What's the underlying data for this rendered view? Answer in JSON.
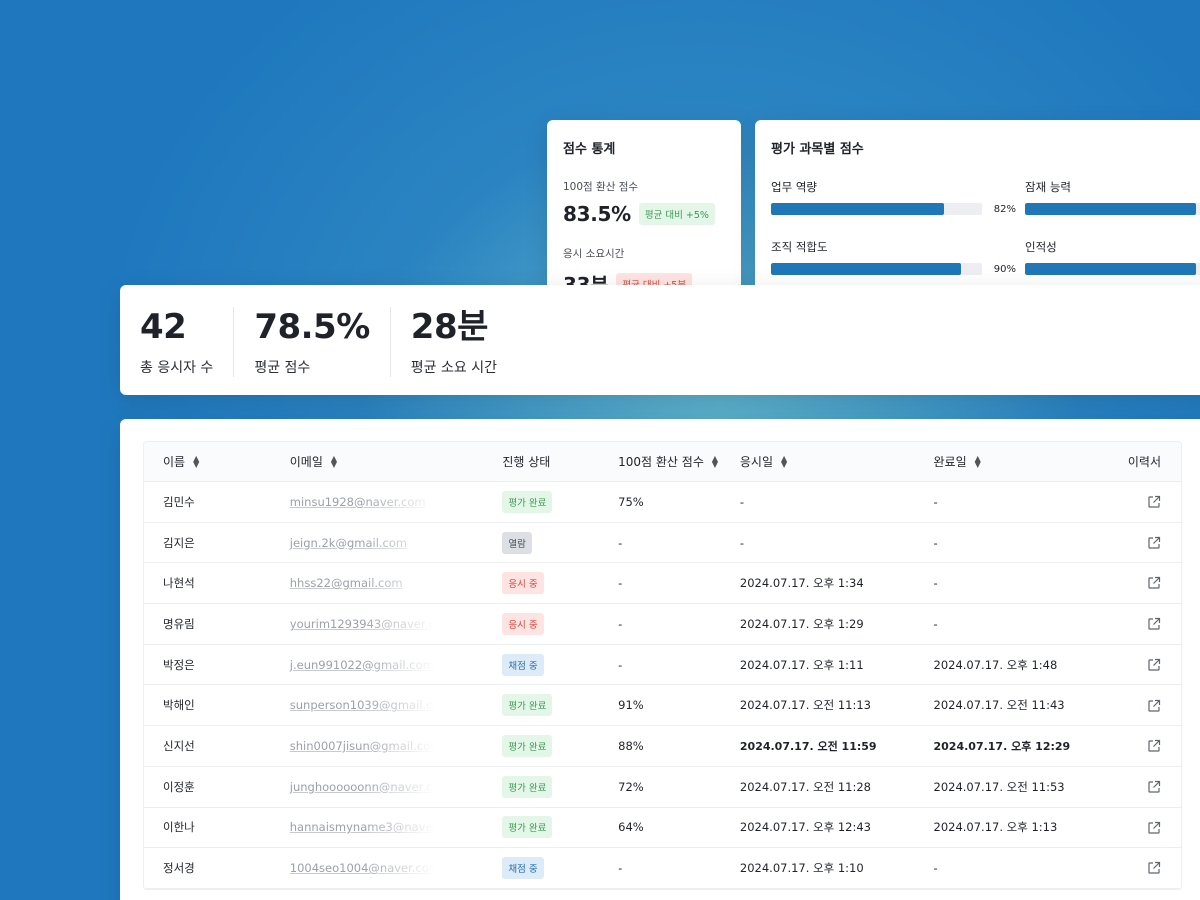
{
  "score_stats": {
    "title": "점수 통계",
    "converted_label": "100점 환산 점수",
    "converted_value": "83.5%",
    "converted_badge": "평균 대비 +5%",
    "time_label": "응시 소요시간",
    "time_value": "33분",
    "time_badge": "평균 대비 +5분"
  },
  "subject_scores": {
    "title": "평가 과목별 점수",
    "items": [
      {
        "label": "업무 역량",
        "percent": 82,
        "percent_text": "82%"
      },
      {
        "label": "잠재 능력",
        "percent": 95,
        "percent_text": ""
      },
      {
        "label": "조직 적합도",
        "percent": 90,
        "percent_text": "90%"
      },
      {
        "label": "인적성",
        "percent": 95,
        "percent_text": ""
      }
    ]
  },
  "summary": {
    "total_value": "42",
    "total_label": "총 응시자 수",
    "avg_score_value": "78.5%",
    "avg_score_label": "평균 점수",
    "avg_time_value": "28분",
    "avg_time_label": "평균 소요 시간"
  },
  "table": {
    "columns": {
      "name": "이름",
      "email": "이메일",
      "status": "진행 상태",
      "score": "100점 환산 점수",
      "start": "응시일",
      "end": "완료일",
      "history": "이력서"
    },
    "rows": [
      {
        "name": "김민수",
        "email": "minsu1928@naver.com",
        "status": "평가 완료",
        "status_type": "done",
        "score": "75%",
        "start": "-",
        "end": "-"
      },
      {
        "name": "김지은",
        "email": "jeign.2k@gmail.com",
        "status": "열람",
        "status_type": "open",
        "score": "-",
        "start": "-",
        "end": "-"
      },
      {
        "name": "나현석",
        "email": "hhss22@gmail.com",
        "status": "응시 중",
        "status_type": "taking",
        "score": "-",
        "start": "2024.07.17. 오후 1:34",
        "end": "-"
      },
      {
        "name": "명유림",
        "email": "yourim1293943@naver.com",
        "status": "응시 중",
        "status_type": "taking",
        "score": "-",
        "start": "2024.07.17. 오후 1:29",
        "end": "-"
      },
      {
        "name": "박정은",
        "email": "j.eun991022@gmail.com",
        "status": "채점 중",
        "status_type": "grading",
        "score": "-",
        "start": "2024.07.17. 오후 1:11",
        "end": "2024.07.17. 오후 1:48"
      },
      {
        "name": "박해인",
        "email": "sunperson1039@gmail.com",
        "status": "평가 완료",
        "status_type": "done",
        "score": "91%",
        "start": "2024.07.17. 오전 11:13",
        "end": "2024.07.17. 오전 11:43"
      },
      {
        "name": "신지선",
        "email": "shin0007jisun@gmail.com",
        "status": "평가 완료",
        "status_type": "done",
        "score": "88%",
        "start": "2024.07.17. 오전 11:59",
        "end": "2024.07.17. 오후 12:29",
        "bold": true
      },
      {
        "name": "이정훈",
        "email": "junghoooooonn@naver.com",
        "status": "평가 완료",
        "status_type": "done",
        "score": "72%",
        "start": "2024.07.17. 오전 11:28",
        "end": "2024.07.17. 오전 11:53"
      },
      {
        "name": "이한나",
        "email": "hannaismyname3@naver.com",
        "status": "평가 완료",
        "status_type": "done",
        "score": "64%",
        "start": "2024.07.17. 오후 12:43",
        "end": "2024.07.17. 오후 1:13"
      },
      {
        "name": "정서경",
        "email": "1004seo1004@naver.com",
        "status": "채점 중",
        "status_type": "grading",
        "score": "-",
        "start": "2024.07.17. 오후 1:10",
        "end": "-"
      }
    ]
  }
}
